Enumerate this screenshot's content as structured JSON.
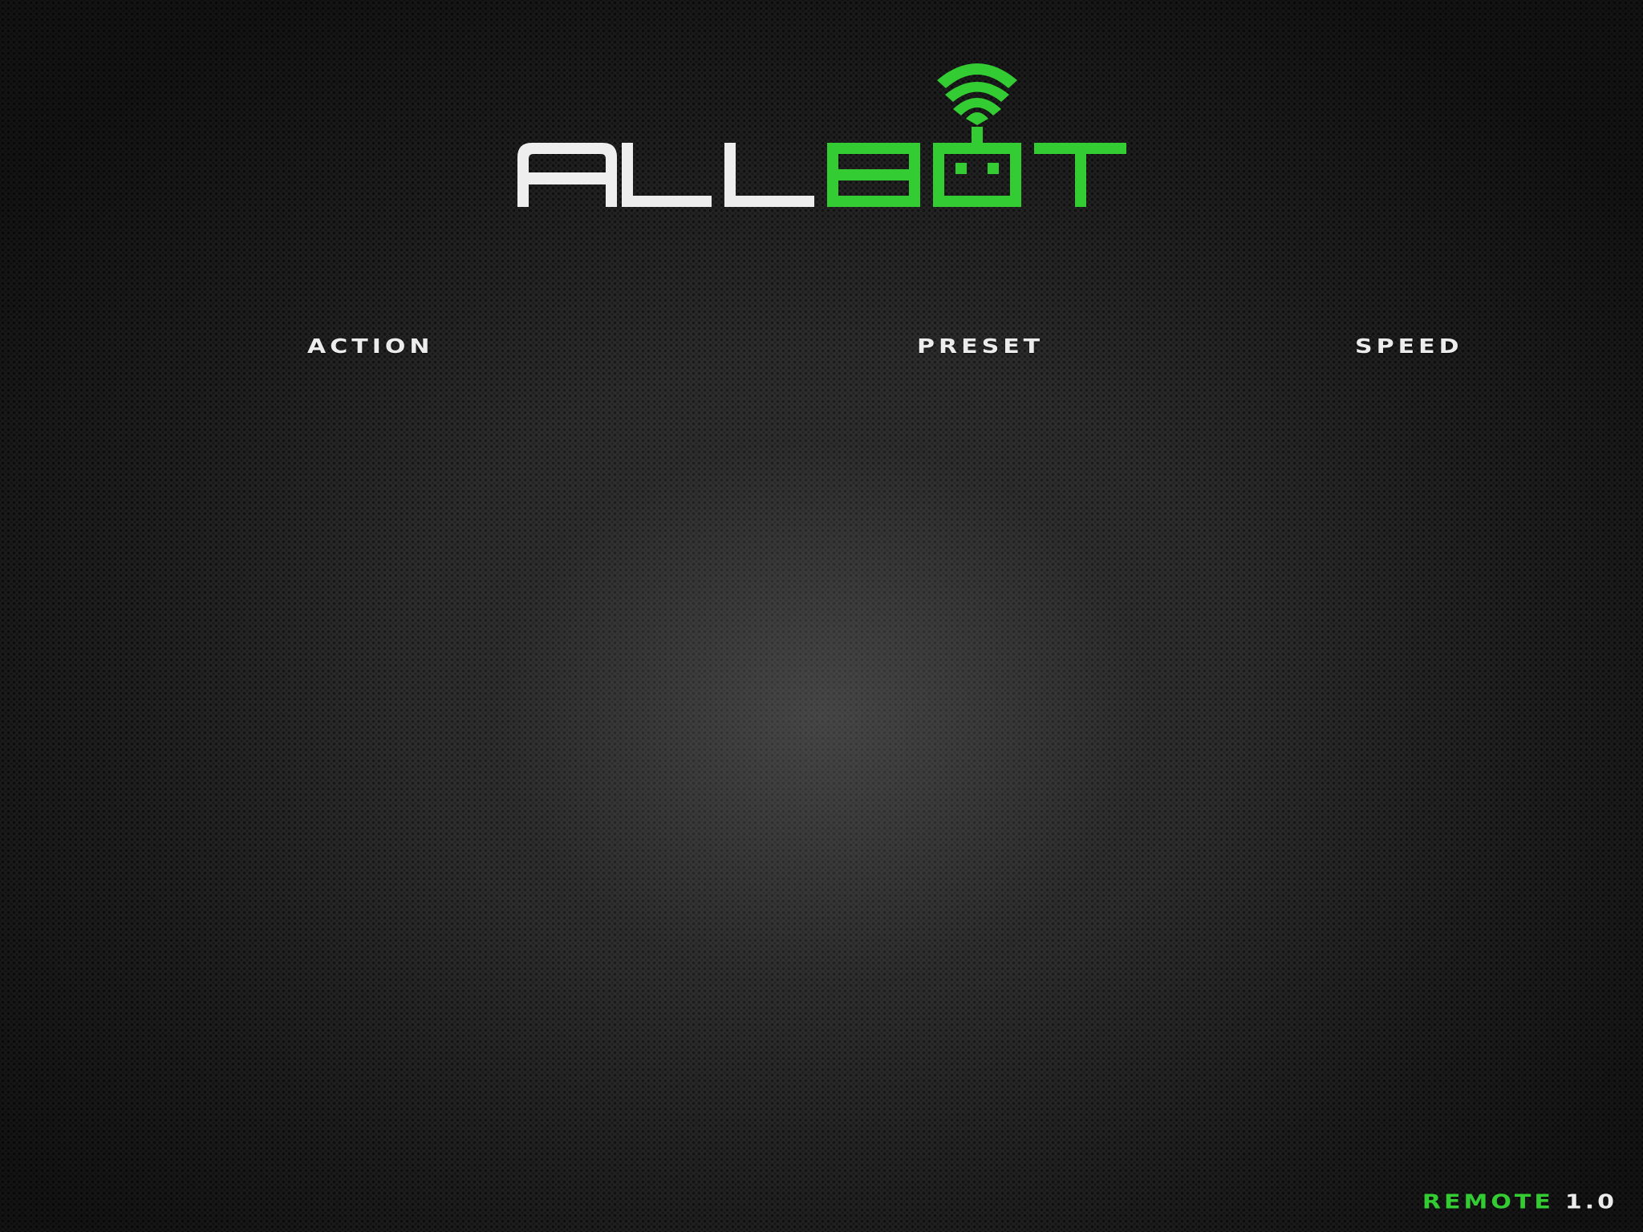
{
  "logo": {
    "wordmark_left": "ALL",
    "wordmark_right": "BOT",
    "icon": "wifi-robot-icon",
    "colors": {
      "white": "#eeeeee",
      "green": "#33cc33"
    }
  },
  "sections": {
    "action": "ACTION",
    "preset": "PRESET",
    "speed": "SPEED"
  },
  "footer": {
    "product": "REMOTE",
    "version": "1.0"
  },
  "theme": {
    "background": "#2b2b2b",
    "accent": "#33cc33",
    "text": "#ececec"
  }
}
